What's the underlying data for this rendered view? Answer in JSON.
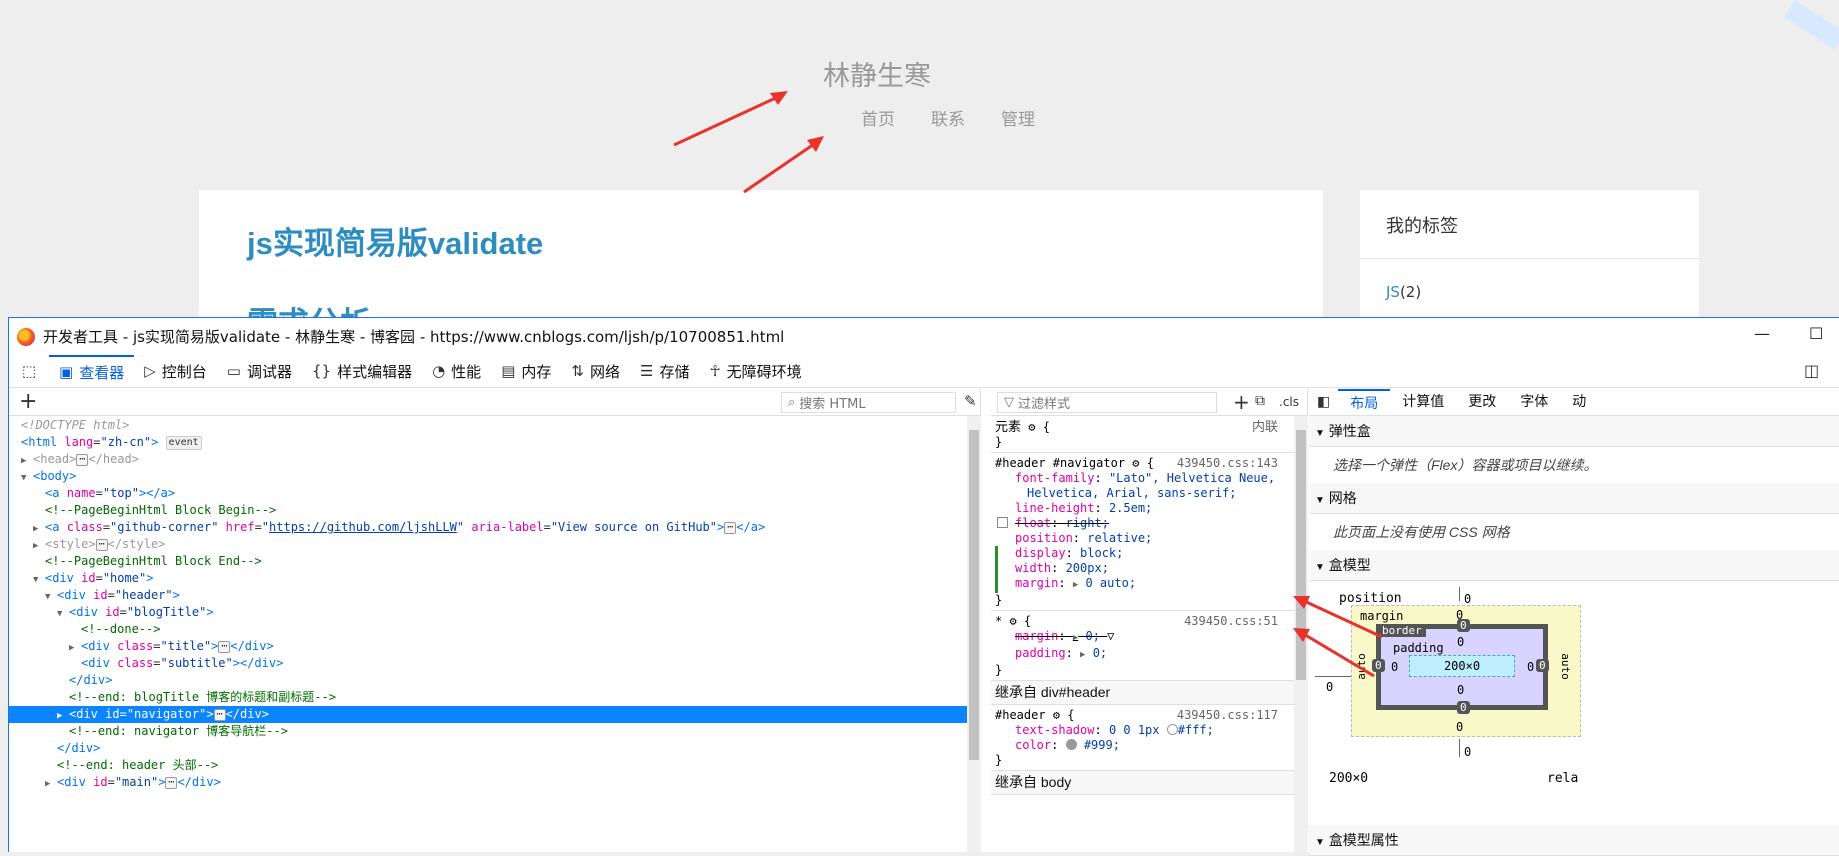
{
  "blog": {
    "title": "林静生寒",
    "nav": [
      "首页",
      "联系",
      "管理"
    ],
    "post_title": "js实现简易版validate",
    "post_subheading": "需求分析",
    "tags_heading": "我的标签",
    "tag_name": "JS",
    "tag_count": "(2)"
  },
  "devtools": {
    "window_title": "开发者工具 - js实现简易版validate - 林静生寒 - 博客园 - https://www.cnblogs.com/ljsh/p/10700851.html",
    "tabs": [
      {
        "label": "查看器",
        "icon": "inspector-icon"
      },
      {
        "label": "控制台",
        "icon": "console-icon"
      },
      {
        "label": "调试器",
        "icon": "debugger-icon"
      },
      {
        "label": "样式编辑器",
        "icon": "style-editor-icon"
      },
      {
        "label": "性能",
        "icon": "performance-icon"
      },
      {
        "label": "内存",
        "icon": "memory-icon"
      },
      {
        "label": "网络",
        "icon": "network-icon"
      },
      {
        "label": "存储",
        "icon": "storage-icon"
      },
      {
        "label": "无障碍环境",
        "icon": "accessibility-icon"
      }
    ],
    "html_search_placeholder": "搜索 HTML",
    "styles_filter_placeholder": "过滤样式",
    "cls_label": ".cls",
    "element_label": "元素",
    "inline_label": "内联",
    "rule1": {
      "selector": "#header #navigator",
      "source": "439450.css:143",
      "props": [
        {
          "name": "font-family",
          "value": "\"Lato\", Helvetica Neue,"
        },
        {
          "name": "",
          "value": "Helvetica, Arial, sans-serif;"
        },
        {
          "name": "line-height",
          "value": "2.5em;"
        },
        {
          "name": "float",
          "value": "right;"
        },
        {
          "name": "position",
          "value": "relative;"
        },
        {
          "name": "display",
          "value": "block;"
        },
        {
          "name": "width",
          "value": "200px;"
        },
        {
          "name": "margin",
          "value": "0 auto;"
        }
      ]
    },
    "rule2": {
      "selector": "*",
      "source": "439450.css:51",
      "margin_name": "margin",
      "margin_value": "0;",
      "padding_name": "padding",
      "padding_value": "0;"
    },
    "inherit1": "继承自 div#header",
    "rule3": {
      "selector": "#header",
      "source": "439450.css:117",
      "ts_name": "text-shadow",
      "ts_value": "0 0 1px",
      "ts_color": "#fff;",
      "color_name": "color",
      "color_value": "#999;"
    },
    "inherit2": "继承自 body",
    "right_tabs": [
      "布局",
      "计算值",
      "更改",
      "字体",
      "动"
    ],
    "flex_head": "弹性盒",
    "flex_body": "选择一个弹性（Flex）容器或项目以继续。",
    "grid_head": "网格",
    "grid_body": "此页面上没有使用 CSS 网格",
    "boxmodel_head": "盒模型",
    "boxmodel": {
      "position_label": "position",
      "position_value": "0",
      "margin_label": "margin",
      "border_label": "border",
      "padding_label": "padding",
      "content": "200×0",
      "m_top": "0",
      "m_bottom": "0",
      "m_left": "auto",
      "m_right": "auto",
      "b_top": "0",
      "b_bottom": "0",
      "b_left": "0",
      "b_right": "0",
      "p_top": "0",
      "p_bottom": "0",
      "p_left": "0",
      "p_right": "0",
      "outer_left": "0",
      "outer_bottom": "0",
      "size": "200×0",
      "pos_kind": "rela"
    },
    "boxprops_head": "盒模型属性",
    "colors": {
      "accent": "#0060df",
      "selection": "#0a84ff",
      "link": "#2d8cc0",
      "arrow": "#e8322b"
    }
  }
}
